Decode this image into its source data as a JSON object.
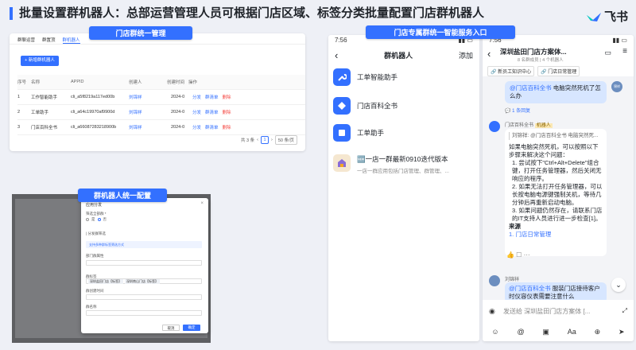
{
  "page_title": "批量设置群机器人：总部运营管理人员可根据门店区域、标签分类批量配置门店群机器人",
  "brand": {
    "name": "飞书",
    "color": "#3370ff"
  },
  "sections": {
    "store_group": "门店群统一管理",
    "bot_config": "群机器人统一配置",
    "entry": "门店专属群统一智能服务入口"
  },
  "admin": {
    "tabs": [
      "群聊运营",
      "群置顶",
      "群机器人"
    ],
    "add_button": "+ 新增群机器人",
    "columns": [
      "序号",
      "名称",
      "APPID",
      "创建人",
      "创建时间",
      "操作"
    ],
    "rows": [
      {
        "no": "1",
        "name": "工作智能助手",
        "appid": "cli_a5f8219a117ed00b",
        "creator": "刘锦祥",
        "time": "2024-0"
      },
      {
        "no": "2",
        "name": "工单助手",
        "appid": "cli_a64c19970af9900d",
        "creator": "刘锦祥",
        "time": "2024-0"
      },
      {
        "no": "3",
        "name": "门店百科全书",
        "appid": "cli_a66087283218900b",
        "creator": "刘锦祥",
        "time": "2024-0"
      }
    ],
    "actions": {
      "dist": "分发",
      "list": "群清单",
      "del": "删除"
    },
    "pager": {
      "total": "共 3 条",
      "page": "1",
      "size": "50 条/页"
    }
  },
  "modal": {
    "title": "应用分发",
    "scope_label": "筛选全部群 *",
    "opt_yes": "是",
    "opt_no": "否",
    "section_label": "| 分发群筛选",
    "hint": "支持多种群标签筛选方式",
    "dept_label": "部门群属性",
    "tag_label": "群标签",
    "tags": [
      "深圳盐田门店【标签】",
      "深圳南山门店【标签】"
    ],
    "date_label": "群创建时间",
    "name_label": "群名称",
    "cancel": "取消",
    "ok": "确定"
  },
  "phone1": {
    "time": "7:56",
    "title": "群机器人",
    "add": "添加",
    "bots": [
      {
        "name": "工单智能助手"
      },
      {
        "name": "门店百科全书"
      },
      {
        "name": "工单助手"
      },
      {
        "name": "🆕一店一群最新0910迭代版本",
        "sub": "一店一群应用包括门店管理、群管理、..."
      }
    ]
  },
  "phone2": {
    "time": "7:56",
    "title": "深圳盐田门店方案体...",
    "members": "8 名群成员  |  4 个机器人",
    "pins": [
      "新员工知识中心",
      "门店日常管理"
    ],
    "user": "锦祥",
    "q1_at": "@门店百科全书",
    "q1": " 电脑突然死机了怎么办",
    "reply_count": "1 条回复",
    "bot_name": "门店百科全书",
    "bot_tag": "机器人",
    "quote": "刘锦祥: @门店百科全书 电脑突然死...",
    "answer_intro": "如果电脑突然死机，可以按照以下步骤来解决这个问题：",
    "steps": [
      "1. 尝试按下\"Ctrl+Alt+Delete\"组合键，打开任务管理器，然后关闭无响应的程序。",
      "2. 如果无法打开任务管理器，可以长按电脑电源键强制关机，等待几分钟后再重新启动电脑。",
      "3. 如果问题仍然存在，请联系门店的IT支持人员进行进一步检查[1]。"
    ],
    "source_label": "来源",
    "source": "1. 门店日常管理",
    "sender2": "刘锦祥",
    "q2_at": "@门店百科全书",
    "q2": " 服装门店接待客户时仪容仪表需要注意什么",
    "input_placeholder": "发送给 深圳盐田门店方案体 [..."
  }
}
